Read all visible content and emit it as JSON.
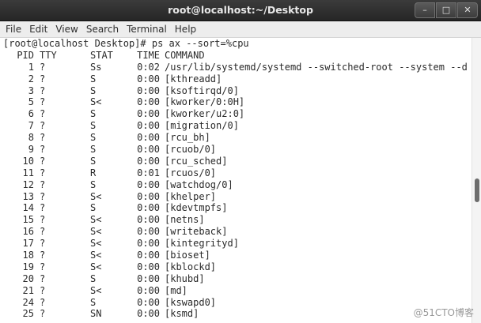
{
  "window": {
    "title": "root@localhost:~/Desktop",
    "min_glyph": "–",
    "max_glyph": "□",
    "close_glyph": "✕"
  },
  "menu": [
    "File",
    "Edit",
    "View",
    "Search",
    "Terminal",
    "Help"
  ],
  "terminal": {
    "prompt": "[root@localhost Desktop]# ps ax --sort=%cpu",
    "header": [
      "PID",
      "TTY",
      "STAT",
      "TIME",
      "COMMAND"
    ],
    "rows": [
      [
        "1",
        "?",
        "Ss",
        "0:02",
        "/usr/lib/systemd/systemd --switched-root --system --d"
      ],
      [
        "2",
        "?",
        "S",
        "0:00",
        "[kthreadd]"
      ],
      [
        "3",
        "?",
        "S",
        "0:00",
        "[ksoftirqd/0]"
      ],
      [
        "5",
        "?",
        "S<",
        "0:00",
        "[kworker/0:0H]"
      ],
      [
        "6",
        "?",
        "S",
        "0:00",
        "[kworker/u2:0]"
      ],
      [
        "7",
        "?",
        "S",
        "0:00",
        "[migration/0]"
      ],
      [
        "8",
        "?",
        "S",
        "0:00",
        "[rcu_bh]"
      ],
      [
        "9",
        "?",
        "S",
        "0:00",
        "[rcuob/0]"
      ],
      [
        "10",
        "?",
        "S",
        "0:00",
        "[rcu_sched]"
      ],
      [
        "11",
        "?",
        "R",
        "0:01",
        "[rcuos/0]"
      ],
      [
        "12",
        "?",
        "S",
        "0:00",
        "[watchdog/0]"
      ],
      [
        "13",
        "?",
        "S<",
        "0:00",
        "[khelper]"
      ],
      [
        "14",
        "?",
        "S",
        "0:00",
        "[kdevtmpfs]"
      ],
      [
        "15",
        "?",
        "S<",
        "0:00",
        "[netns]"
      ],
      [
        "16",
        "?",
        "S<",
        "0:00",
        "[writeback]"
      ],
      [
        "17",
        "?",
        "S<",
        "0:00",
        "[kintegrityd]"
      ],
      [
        "18",
        "?",
        "S<",
        "0:00",
        "[bioset]"
      ],
      [
        "19",
        "?",
        "S<",
        "0:00",
        "[kblockd]"
      ],
      [
        "20",
        "?",
        "S",
        "0:00",
        "[khubd]"
      ],
      [
        "21",
        "?",
        "S<",
        "0:00",
        "[md]"
      ],
      [
        "24",
        "?",
        "S",
        "0:00",
        "[kswapd0]"
      ],
      [
        "25",
        "?",
        "SN",
        "0:00",
        "[ksmd]"
      ]
    ]
  },
  "watermark": "@51CTO博客"
}
